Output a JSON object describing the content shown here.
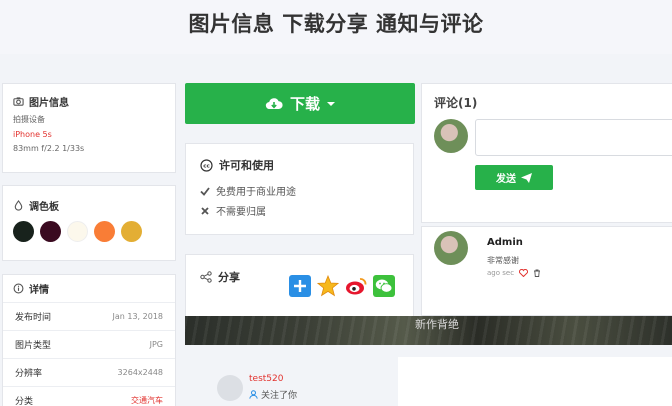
{
  "headline": "图片信息 下载分享 通知与评论",
  "info": {
    "title": "图片信息",
    "device_label": "拍摄设备",
    "device": "iPhone 5s",
    "exif": "83mm  f/2.2  1/33s"
  },
  "palette": {
    "title": "调色板",
    "colors": [
      "#18221c",
      "#3a0a20",
      "#fcf8ec",
      "#f97d36",
      "#e3ae34"
    ]
  },
  "details": {
    "title": "详情",
    "rows": [
      {
        "label": "发布时间",
        "value": "Jan 13, 2018"
      },
      {
        "label": "图片类型",
        "value": "JPG"
      },
      {
        "label": "分辨率",
        "value": "3264x2448"
      },
      {
        "label": "分类",
        "value": "交通汽车"
      }
    ]
  },
  "download": {
    "label": "下载"
  },
  "license": {
    "title": "许可和使用",
    "free": "免费用于商业用途",
    "no_attribution": "不需要归属"
  },
  "share": {
    "title": "分享"
  },
  "photo_caption": "新作背绝",
  "comments": {
    "title": "评论(1)",
    "send_label": "发送",
    "entry": {
      "user": "Admin",
      "text": "非常感谢",
      "time": "ago sec"
    }
  },
  "follow": {
    "user": "test520",
    "text": "关注了你"
  },
  "accent": "#27b14a"
}
